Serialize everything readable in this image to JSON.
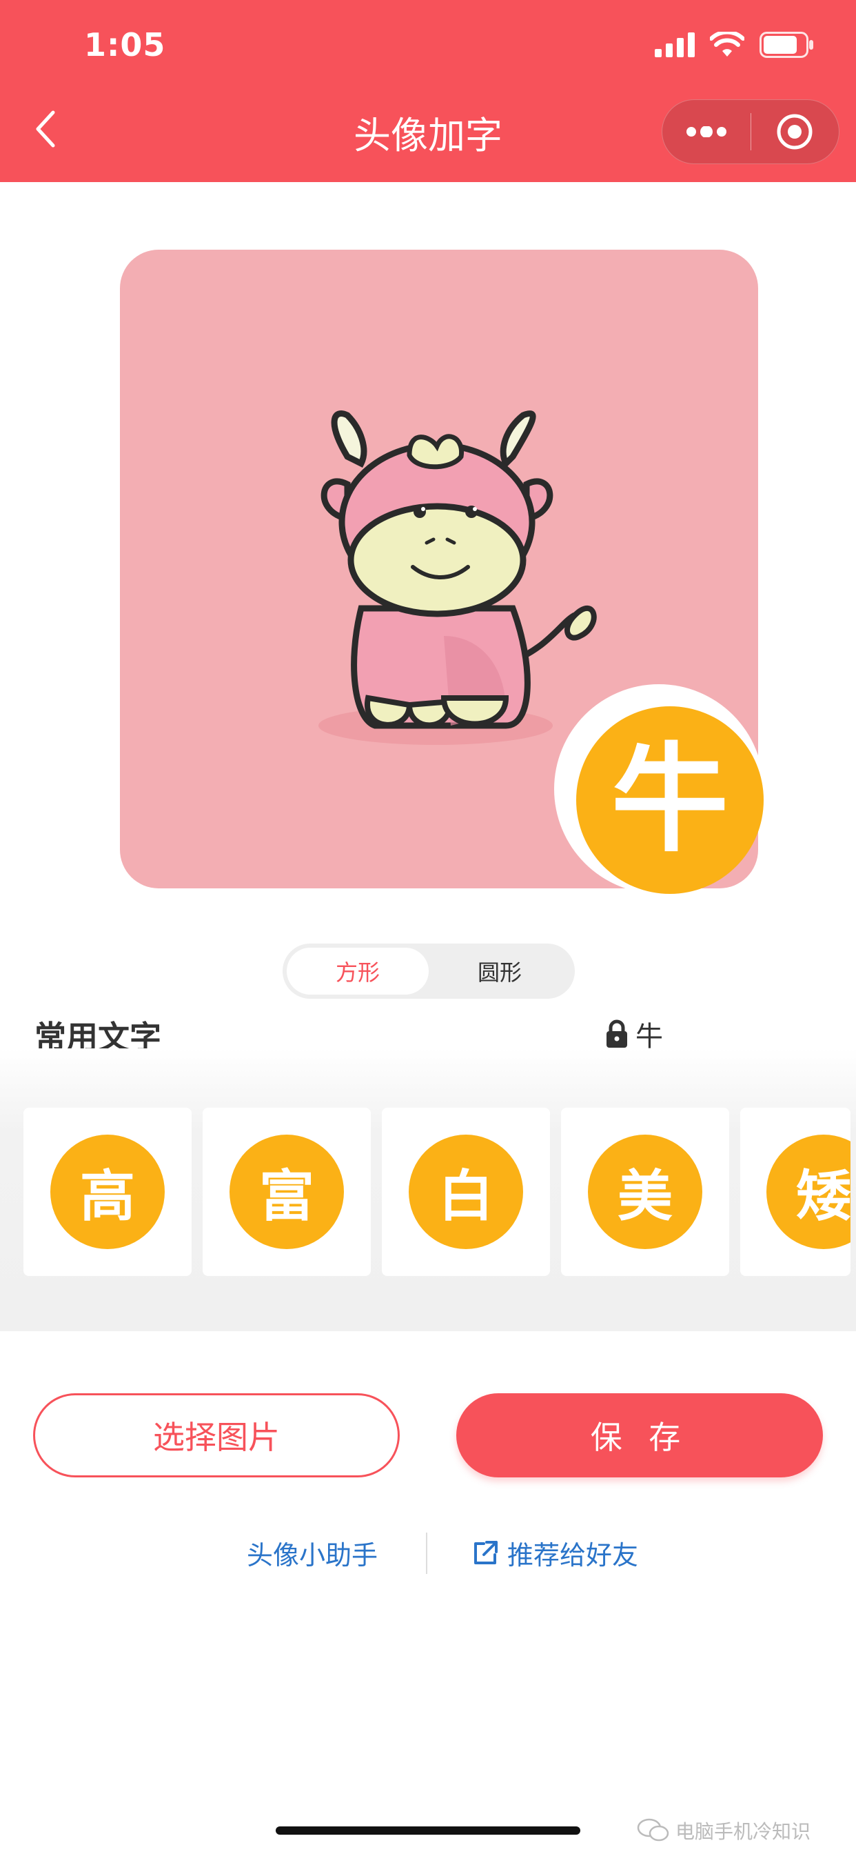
{
  "status_bar": {
    "time": "1:05",
    "battery_level": 0.8
  },
  "nav": {
    "title": "头像加字",
    "back_icon": "chevron-left-icon",
    "more_icon": "more-dots-icon",
    "close_icon": "target-close-icon"
  },
  "preview": {
    "badge_text": "牛",
    "background_color": "#f3aeb3",
    "badge_color": "#fbb116",
    "image": "cartoon-ox-illustration"
  },
  "shape_options": [
    {
      "label": "方形",
      "active": true
    },
    {
      "label": "圆形",
      "active": false
    }
  ],
  "common_text": {
    "title": "常用文字",
    "locked_char": "牛",
    "lock_icon": "lock-icon"
  },
  "char_options": [
    "高",
    "富",
    "白",
    "美",
    "矮"
  ],
  "actions": {
    "select_image": "选择图片",
    "save": "保 存"
  },
  "links": {
    "assistant": "头像小助手",
    "share": "推荐给好友",
    "share_icon": "external-link-icon"
  },
  "watermark": {
    "text": "电脑手机冷知识",
    "icon": "wechat-icon"
  },
  "colors": {
    "primary": "#f7525a",
    "accent": "#fbb116",
    "link": "#2a74c9"
  }
}
